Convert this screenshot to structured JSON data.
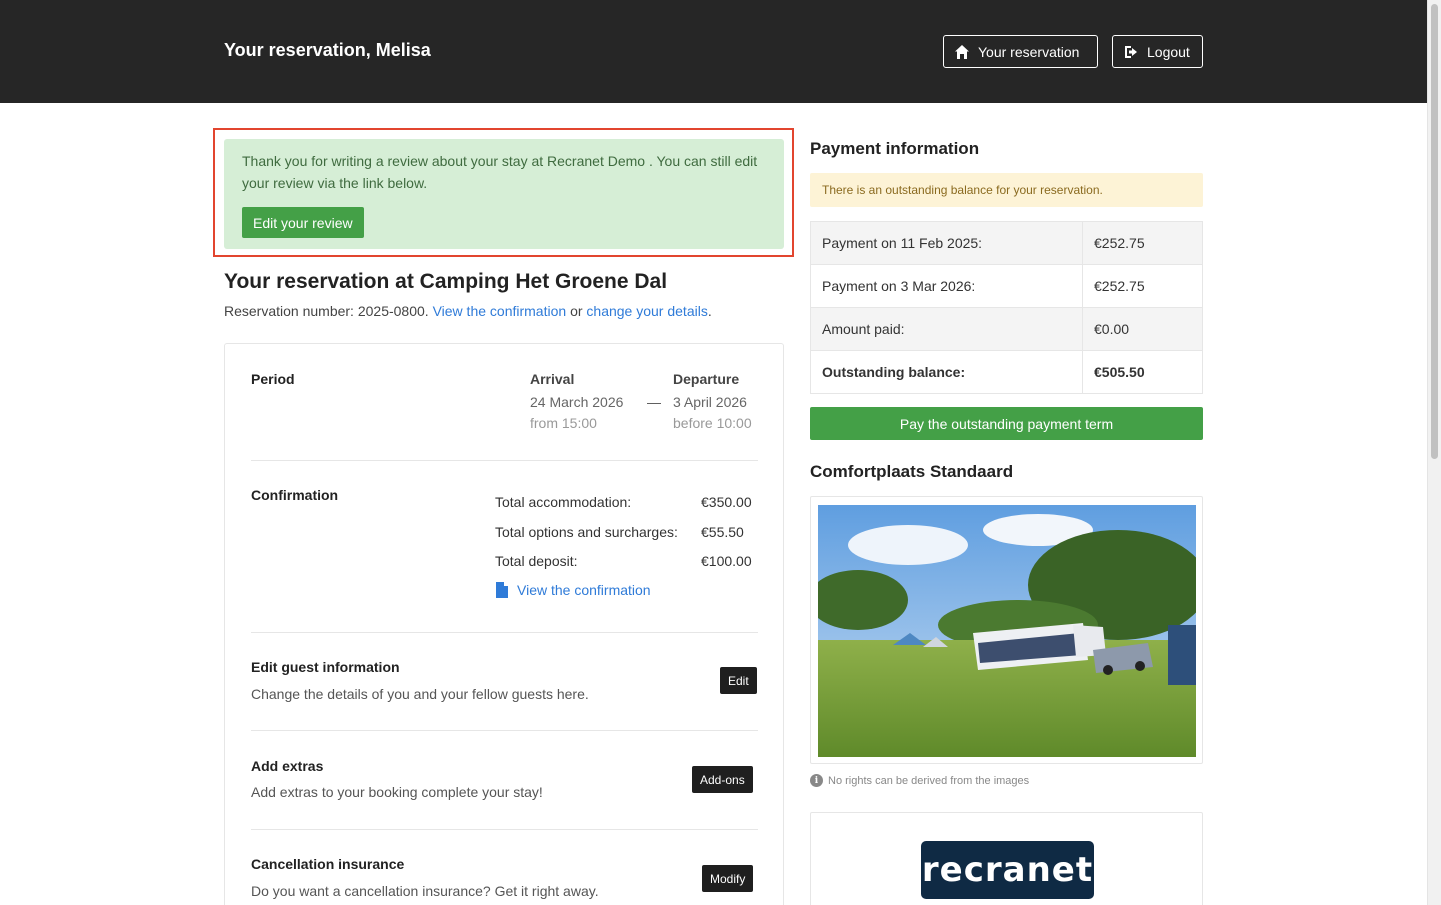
{
  "header": {
    "title": "Your reservation, Melisa",
    "reservation_button": "Your reservation",
    "logout_button": "Logout"
  },
  "alert": {
    "message": "Thank you for writing a review about your stay at Recranet Demo . You can still edit your review via the link below.",
    "edit_button": "Edit your review"
  },
  "reservation": {
    "title": "Your reservation at Camping Het Groene Dal",
    "number_text": "Reservation number: 2025-0800.",
    "view_link": "View the confirmation",
    "or_text": "or",
    "change_link": "change your details",
    "end_dot": "."
  },
  "period": {
    "label": "Period",
    "arrival_label": "Arrival",
    "arrival_date": "24 March 2026",
    "arrival_time": "from 15:00",
    "separator": "—",
    "departure_label": "Departure",
    "departure_date": "3 April 2026",
    "departure_time": "before 10:00"
  },
  "confirmation": {
    "label": "Confirmation",
    "rows": [
      {
        "label": "Total accommodation:",
        "value": "€350.00"
      },
      {
        "label": "Total options and surcharges:",
        "value": "€55.50"
      },
      {
        "label": "Total deposit:",
        "value": "€100.00"
      }
    ],
    "view_link": "View the confirmation"
  },
  "guest": {
    "label": "Edit guest information",
    "desc": "Change the details of you and your fellow guests here.",
    "button": "Edit"
  },
  "extras": {
    "label": "Add extras",
    "desc": "Add extras to your booking complete your stay!",
    "button": "Add-ons"
  },
  "insurance": {
    "label": "Cancellation insurance",
    "desc": "Do you want a cancellation insurance? Get it right away.",
    "button": "Modify"
  },
  "payment": {
    "title": "Payment information",
    "warning": "There is an outstanding balance for your reservation.",
    "rows": [
      {
        "label": "Payment on 11 Feb 2025:",
        "value": "€252.75"
      },
      {
        "label": "Payment on 3 Mar 2026:",
        "value": "€252.75"
      },
      {
        "label": "Amount paid:",
        "value": "€0.00"
      },
      {
        "label": "Outstanding balance:",
        "value": "€505.50"
      }
    ],
    "pay_button": "Pay the outstanding payment term"
  },
  "accommodation": {
    "title": "Comfortplaats Standaard",
    "note": "No rights can be derived from the images"
  },
  "logo": {
    "text": "recranet"
  },
  "colors": {
    "header_bg": "#262626",
    "accent_green": "#44a047",
    "link_blue": "#2f7bd8",
    "highlight_red": "#e2452f"
  }
}
